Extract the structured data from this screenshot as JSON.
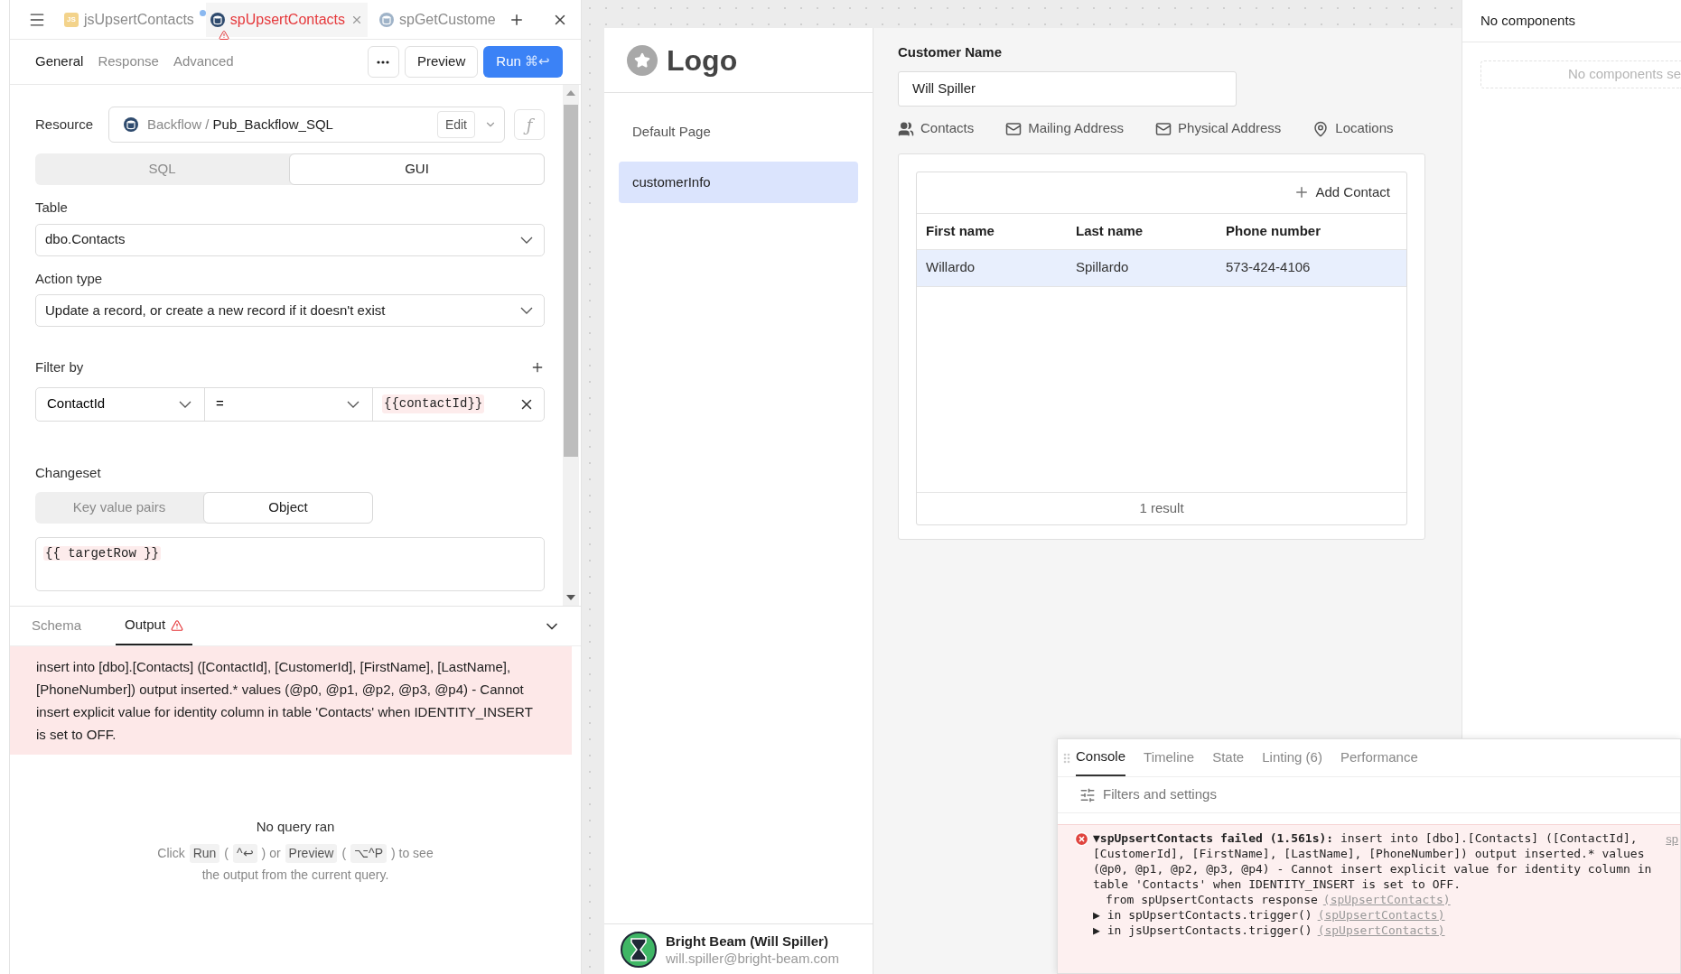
{
  "editor_tabs": [
    {
      "label": "jsUpsertContacts",
      "kind": "js",
      "badge": "JS",
      "selected": false,
      "modified": true,
      "error": false
    },
    {
      "label": "spUpsertContacts",
      "kind": "sql",
      "selected": true,
      "modified": false,
      "error": true
    },
    {
      "label": "spGetCustome",
      "kind": "sql",
      "selected": false,
      "modified": false,
      "error": false
    }
  ],
  "query_tabs": [
    {
      "label": "General",
      "selected": true
    },
    {
      "label": "Response",
      "selected": false
    },
    {
      "label": "Advanced",
      "selected": false
    }
  ],
  "toolbar": {
    "preview": "Preview",
    "run": "Run",
    "run_shortcut": "⌘↩"
  },
  "resource": {
    "label": "Resource",
    "folder": "Backflow",
    "separator": "/",
    "name": "Pub_Backflow_SQL",
    "edit": "Edit",
    "fx": "ƒ"
  },
  "mode_toggle": [
    {
      "label": "SQL",
      "selected": false
    },
    {
      "label": "GUI",
      "selected": true
    }
  ],
  "table": {
    "label": "Table",
    "value": "dbo.Contacts"
  },
  "action_type": {
    "label": "Action type",
    "value": "Update a record, or create a new record if it doesn't exist"
  },
  "filter": {
    "label": "Filter by",
    "column": "ContactId",
    "operator": "=",
    "value": "{{contactId}}"
  },
  "changeset": {
    "label": "Changeset",
    "modes": [
      {
        "label": "Key value pairs",
        "selected": false
      },
      {
        "label": "Object",
        "selected": true
      }
    ],
    "value": "{{ targetRow }}"
  },
  "results_tabs": [
    {
      "label": "Schema",
      "selected": false,
      "warning": false
    },
    {
      "label": "Output",
      "selected": true,
      "warning": true
    }
  ],
  "error_message": "insert into [dbo].[Contacts] ([ContactId], [CustomerId], [FirstName], [LastName], [PhoneNumber]) output inserted.* values (@p0, @p1, @p2, @p3, @p4) - Cannot insert explicit value for identity column in table 'Contacts' when IDENTITY_INSERT is set to OFF.",
  "empty_state": {
    "title": "No query ran",
    "hint": [
      {
        "kind": "text",
        "text": "Click"
      },
      {
        "kind": "key",
        "text": "Run"
      },
      {
        "kind": "text",
        "text": "("
      },
      {
        "kind": "key",
        "text": "^↩"
      },
      {
        "kind": "text",
        "text": ") or"
      },
      {
        "kind": "key",
        "text": "Preview"
      },
      {
        "kind": "text",
        "text": "("
      },
      {
        "kind": "key",
        "text": "⌥^P"
      },
      {
        "kind": "text",
        "text": ") to see"
      }
    ],
    "hint_line_2": "the output from the current query."
  },
  "app": {
    "logo": "Logo",
    "pages": [
      {
        "label": "Default Page",
        "selected": false
      },
      {
        "label": "customerInfo",
        "selected": true
      }
    ],
    "user": {
      "name": "Bright Beam (Will Spiller)",
      "email": "will.spiller@bright-beam.com"
    },
    "customer_name": {
      "label": "Customer Name",
      "value": "Will Spiller"
    },
    "section_tabs": [
      {
        "label": "Contacts",
        "kind": "people"
      },
      {
        "label": "Mailing Address",
        "kind": "mail"
      },
      {
        "label": "Physical Address",
        "kind": "mail"
      },
      {
        "label": "Locations",
        "kind": "pin"
      }
    ],
    "contacts": {
      "add": "Add Contact",
      "columns": [
        "First name",
        "Last name",
        "Phone number"
      ],
      "rows": [
        {
          "cells": [
            "Willardo",
            "Spillardo",
            "573-424-4106"
          ],
          "selected": true
        }
      ],
      "footer": "1 result"
    }
  },
  "inspector": {
    "title": "No components",
    "empty": "No components se"
  },
  "console": {
    "tabs": [
      {
        "label": "Console",
        "selected": true
      },
      {
        "label": "Timeline",
        "selected": false
      },
      {
        "label": "State",
        "selected": false
      },
      {
        "label": "Linting (6)",
        "selected": false
      },
      {
        "label": "Performance",
        "selected": false
      }
    ],
    "filters": "Filters and settings",
    "entry": {
      "toggle": "▼",
      "message": "**spUpsertContacts failed (1.561s):** insert into [dbo].[Contacts] ([ContactId], [CustomerId], [FirstName], [LastName], [PhoneNumber]) output inserted.* values (@p0, @p1, @p2, @p3, @p4) - Cannot insert explicit value for identity column in table 'Contacts' when IDENTITY_INSERT is set to OFF.",
      "source": "sp",
      "stack": [
        {
          "kind": "from",
          "text": "from spUpsertContacts response",
          "link": "(spUpsertContacts)"
        },
        {
          "kind": "trace",
          "marker": "▶",
          "text": "in spUpsertContacts.trigger()",
          "link": "(spUpsertContacts)"
        },
        {
          "kind": "trace",
          "marker": "▶",
          "text": "in jsUpsertContacts.trigger()",
          "link": "(spUpsertContacts)"
        }
      ]
    }
  }
}
